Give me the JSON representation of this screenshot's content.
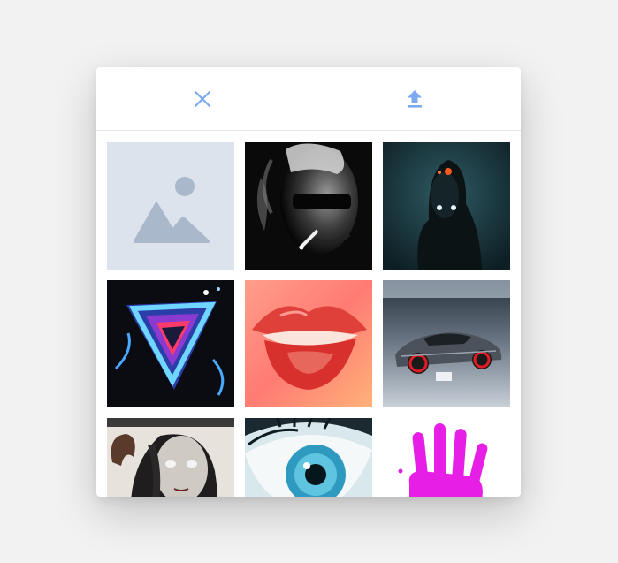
{
  "toolbar": {
    "close_icon": "close-icon",
    "upload_icon": "upload-icon",
    "icon_color": "#7baaf0"
  },
  "gallery": {
    "images": [
      {
        "subject": "placeholder",
        "icon": "image-placeholder-icon"
      },
      {
        "subject": "smoking-man-sunglasses"
      },
      {
        "subject": "hooded-figure-glowing-eyes"
      },
      {
        "subject": "neon-triangle-art"
      },
      {
        "subject": "red-lips"
      },
      {
        "subject": "sports-car"
      },
      {
        "subject": "pale-woman-with-horns"
      },
      {
        "subject": "blue-eye-closeup"
      },
      {
        "subject": "magenta-handprint"
      }
    ]
  }
}
